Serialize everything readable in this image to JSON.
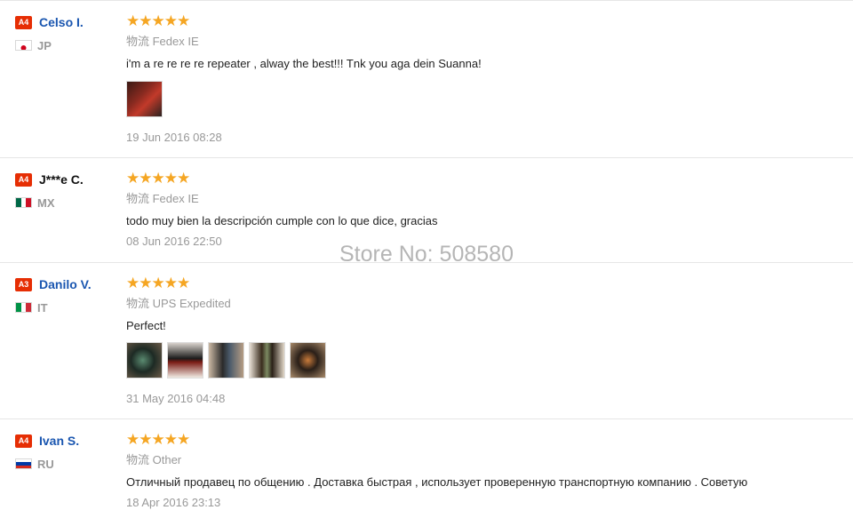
{
  "colors": {
    "badge_bg": "#e62e04",
    "name_link": "#1a56b0",
    "star": "#f5a623",
    "muted": "#999999"
  },
  "star_icon": "★★★★★",
  "reviews": [
    {
      "level": "A4",
      "name": "Celso I.",
      "name_color": "#1a56b0",
      "country": "JP",
      "flag": "japan-flag-icon",
      "rating": 5,
      "shipping": "物流 Fedex IE",
      "comment": "i'm a re re re re repeater , alway the best!!! Tnk you aga dein Suanna!",
      "photos": 1,
      "date": "19 Jun 2016 08:28"
    },
    {
      "level": "A4",
      "name": "J***e C.",
      "name_color": "#111111",
      "country": "MX",
      "flag": "mexico-flag-icon",
      "rating": 5,
      "shipping": "物流 Fedex IE",
      "comment": "todo muy bien la descripción cumple con lo que dice, gracias",
      "photos": 0,
      "date": "08 Jun 2016 22:50"
    },
    {
      "level": "A3",
      "name": "Danilo V.",
      "name_color": "#1a56b0",
      "country": "IT",
      "flag": "italy-flag-icon",
      "rating": 5,
      "shipping": "物流 UPS Expedited",
      "comment": "Perfect!",
      "photos": 5,
      "date": "31 May 2016 04:48"
    },
    {
      "level": "A4",
      "name": "Ivan S.",
      "name_color": "#1a56b0",
      "country": "RU",
      "flag": "russia-flag-icon",
      "rating": 5,
      "shipping": "物流 Other",
      "comment": "Отличный продавец по общению . Доставка быстрая , использует проверенную транспортную компанию . Советую",
      "photos": 0,
      "date": "18 Apr 2016 23:13"
    }
  ],
  "watermark": "Store No: 508580"
}
